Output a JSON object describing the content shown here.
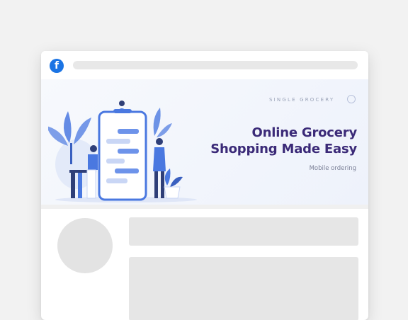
{
  "post": {
    "network_icon": "facebook-icon",
    "network_icon_glyph": "f",
    "banner": {
      "brand": "SINGLE GROCERY",
      "headline_line1": "Online Grocery",
      "headline_line2": "Shopping Made Easy",
      "subtitle": "Mobile ordering"
    }
  },
  "colors": {
    "facebook_blue": "#1b74e4",
    "headline": "#3b2a78",
    "illustration_blue": "#4a78e0"
  }
}
